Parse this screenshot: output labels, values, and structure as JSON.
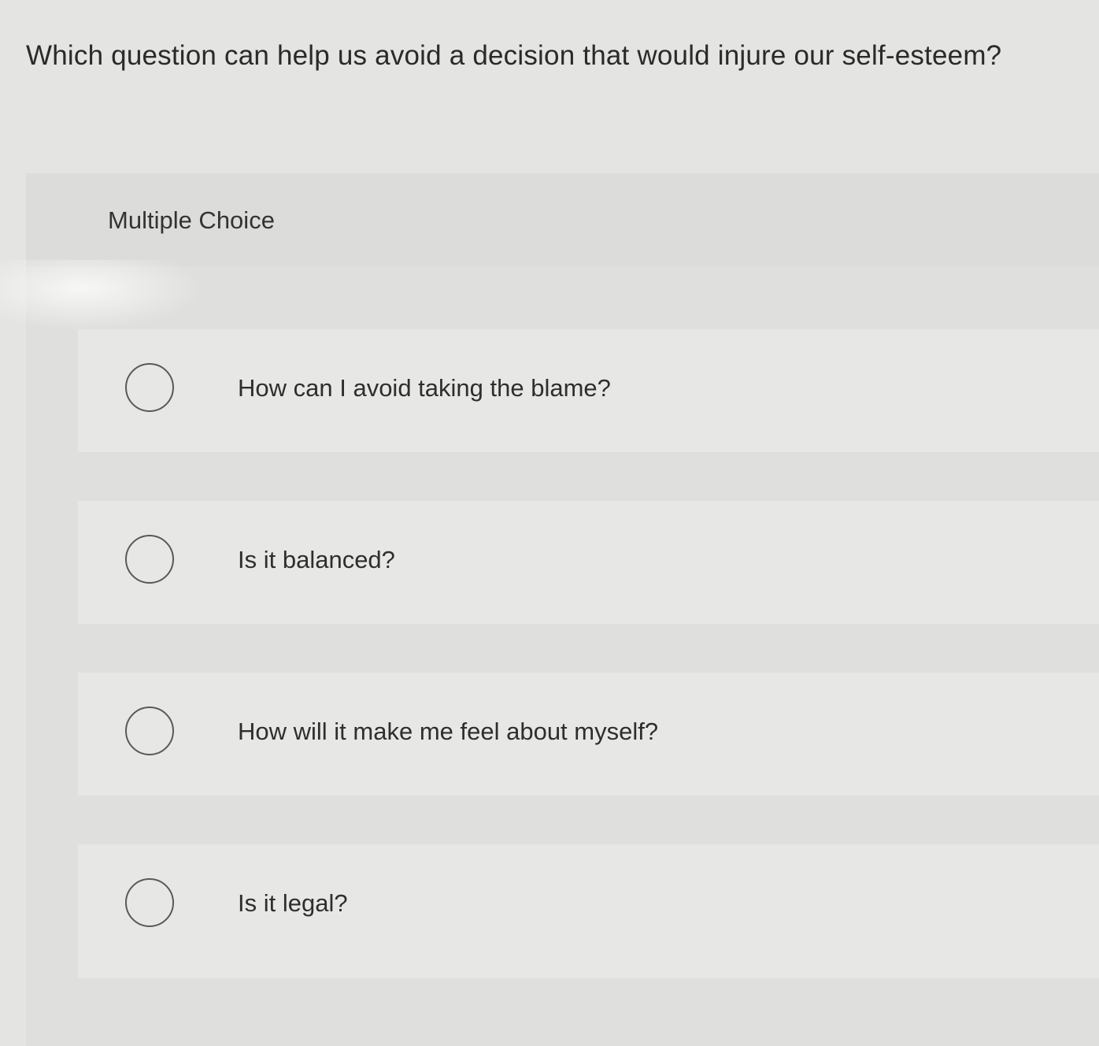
{
  "question": {
    "text": "Which question can help us avoid a decision that would injure our self-esteem?"
  },
  "panel": {
    "type_label": "Multiple Choice"
  },
  "options": [
    {
      "label": "How can I avoid taking the blame?",
      "selected": false
    },
    {
      "label": "Is it balanced?",
      "selected": false
    },
    {
      "label": "How will it make me feel about myself?",
      "selected": false
    },
    {
      "label": "Is it legal?",
      "selected": false
    }
  ]
}
